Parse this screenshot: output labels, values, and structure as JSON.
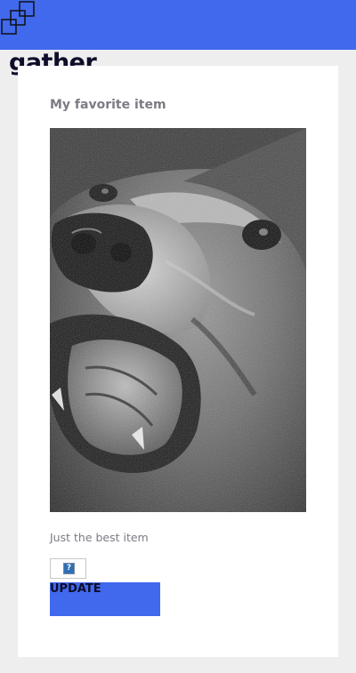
{
  "app": {
    "brand": "gather",
    "logo_icon": "overlapping-squares-icon",
    "accent_color": "#4169ee"
  },
  "card": {
    "title": "My favorite item",
    "image_subject": "bear",
    "description": "Just the best item",
    "broken_image_icon": "broken-image-icon",
    "update_label": "UPDATE"
  }
}
